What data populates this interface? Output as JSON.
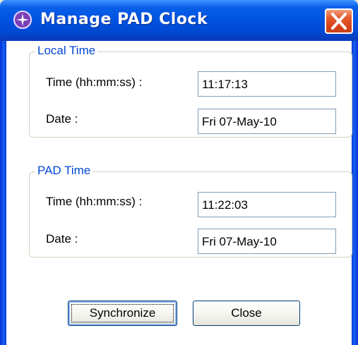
{
  "window": {
    "title": "Manage PAD Clock",
    "icon": "clock-app-icon",
    "close_icon": "close-x-icon"
  },
  "local_time": {
    "group_label": "Local Time",
    "time_label": "Time (hh:mm:ss) :",
    "time_value": "11:17:13",
    "date_label": "Date :",
    "date_value": "Fri 07-May-10"
  },
  "pad_time": {
    "group_label": "PAD Time",
    "time_label": "Time (hh:mm:ss) :",
    "time_value": "11:22:03",
    "date_label": "Date :",
    "date_value": "Fri 07-May-10"
  },
  "buttons": {
    "synchronize": "Synchronize",
    "close": "Close"
  },
  "colors": {
    "titlebar": "#0054e3",
    "group_title": "#0046d5",
    "close_button": "#d9441a"
  }
}
